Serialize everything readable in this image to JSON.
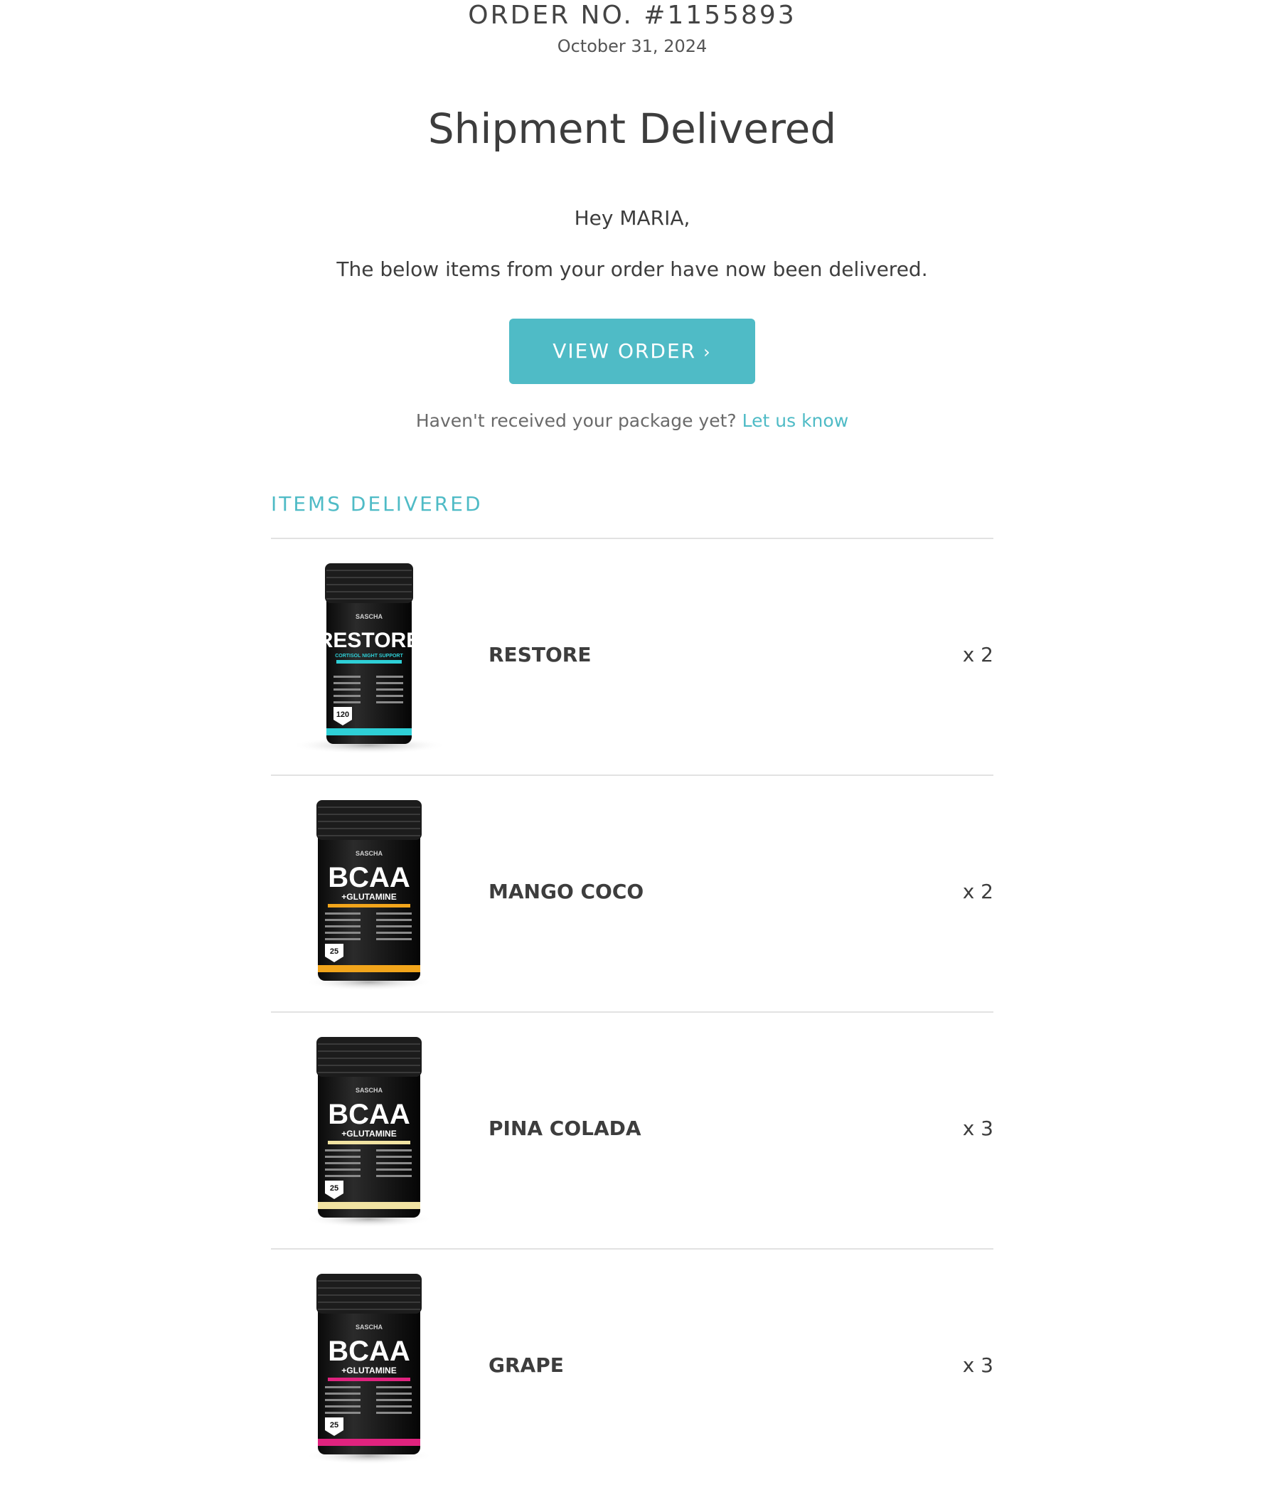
{
  "order": {
    "number": "ORDER NO. #1155893",
    "date": "October 31, 2024"
  },
  "headline": "Shipment Delivered",
  "greeting": "Hey MARIA,",
  "message": "The below items from your order have now been delivered.",
  "cta": {
    "label": "VIEW ORDER",
    "chevron": "›"
  },
  "help": {
    "text": "Haven't received your package yet?",
    "link": "Let us know"
  },
  "section_title": "ITEMS DELIVERED",
  "colors": {
    "accent": "#4fbbc6",
    "text": "#3d3d3d",
    "divider": "#e2e2e2"
  },
  "items": [
    {
      "name": "RESTORE",
      "qty": "x 2",
      "product": {
        "brand": "SASCHA",
        "title": "RESTORE",
        "sub": "CORTISOL NIGHT SUPPORT",
        "count": "120",
        "band_color": "#2ecfd6",
        "kind": "capsule"
      }
    },
    {
      "name": "MANGO COCO",
      "qty": "x 2",
      "product": {
        "brand": "SASCHA",
        "title": "BCAA",
        "sub": "+GLUTAMINE",
        "count": "25",
        "band_color": "#f2a51b",
        "kind": "powder"
      }
    },
    {
      "name": "PINA COLADA",
      "qty": "x 3",
      "product": {
        "brand": "SASCHA",
        "title": "BCAA",
        "sub": "+GLUTAMINE",
        "count": "25",
        "band_color": "#f1e3a2",
        "kind": "powder"
      }
    },
    {
      "name": "GRAPE",
      "qty": "x 3",
      "product": {
        "brand": "SASCHA",
        "title": "BCAA",
        "sub": "+GLUTAMINE",
        "count": "25",
        "band_color": "#e0237f",
        "kind": "powder"
      }
    }
  ]
}
